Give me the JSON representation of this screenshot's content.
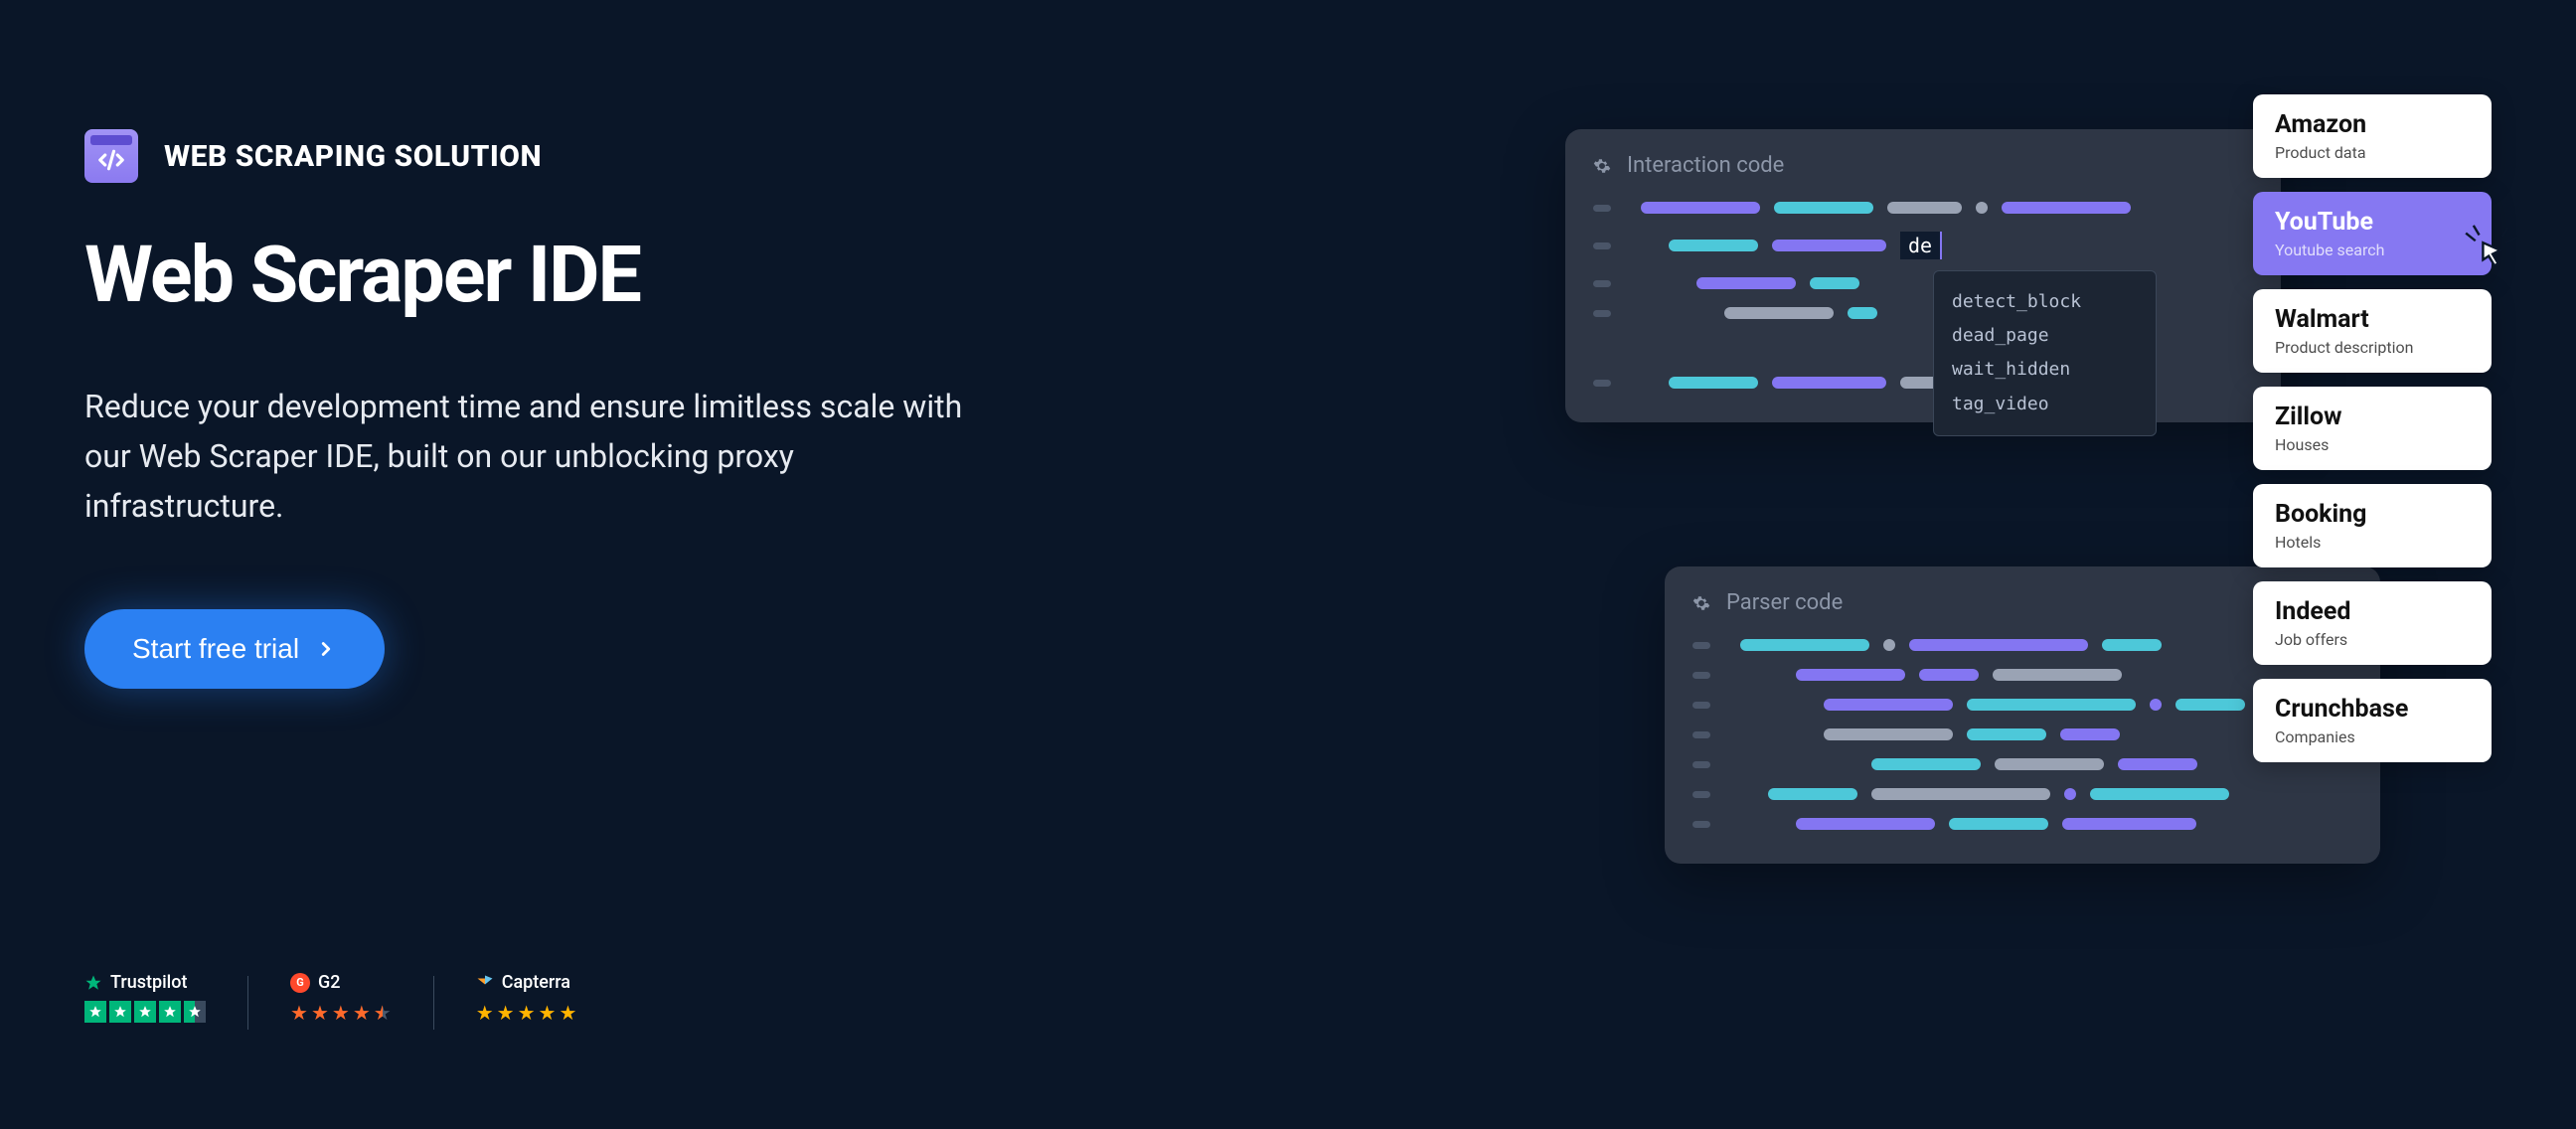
{
  "eyebrow": {
    "label": "WEB SCRAPING SOLUTION"
  },
  "heading": "Web Scraper IDE",
  "subtext": "Reduce your development time and ensure limitless scale with our Web Scraper IDE, built on our unblocking proxy infrastructure.",
  "cta": {
    "label": "Start free trial"
  },
  "reviews": {
    "trustpilot": {
      "name": "Trustpilot",
      "rating": 4.5
    },
    "g2": {
      "name": "G2",
      "rating": 4.5
    },
    "capterra": {
      "name": "Capterra",
      "rating": 5
    }
  },
  "panels": {
    "interaction": {
      "title": "Interaction code",
      "typed": "de",
      "autocomplete": [
        "detect_block",
        "dead_page",
        "wait_hidden",
        "tag_video"
      ]
    },
    "parser": {
      "title": "Parser code"
    }
  },
  "templates": [
    {
      "title": "Amazon",
      "sub": "Product data",
      "active": false
    },
    {
      "title": "YouTube",
      "sub": "Youtube search",
      "active": true
    },
    {
      "title": "Walmart",
      "sub": "Product description",
      "active": false
    },
    {
      "title": "Zillow",
      "sub": "Houses",
      "active": false
    },
    {
      "title": "Booking",
      "sub": "Hotels",
      "active": false
    },
    {
      "title": "Indeed",
      "sub": "Job offers",
      "active": false
    },
    {
      "title": "Crunchbase",
      "sub": "Companies",
      "active": false
    }
  ]
}
